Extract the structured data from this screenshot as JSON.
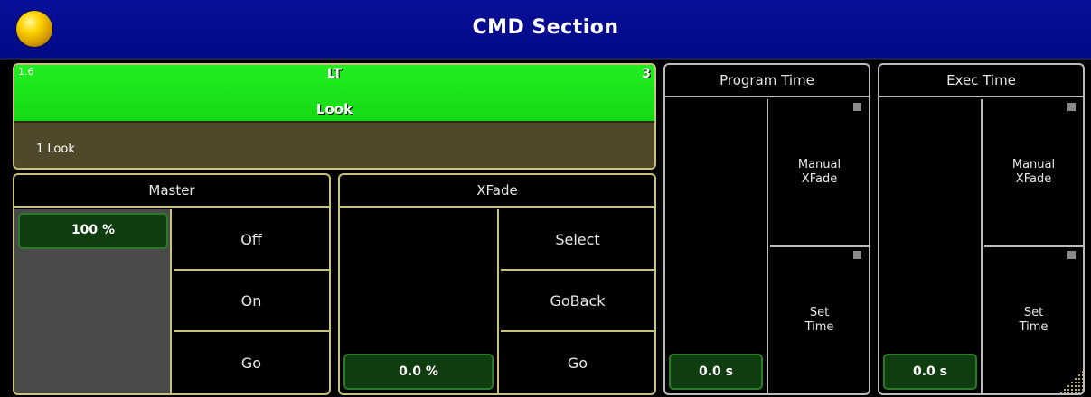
{
  "window": {
    "title": "CMD Section"
  },
  "executor": {
    "id": "1.6",
    "type": "LT",
    "count": "3",
    "name": "Look",
    "cue": "1 Look"
  },
  "master": {
    "title": "Master",
    "value": "100 %",
    "buttons": [
      "Off",
      "On",
      "Go"
    ]
  },
  "xfade": {
    "title": "XFade",
    "value": "0.0 %",
    "buttons": [
      "Select",
      "GoBack",
      "Go"
    ]
  },
  "program_time": {
    "title": "Program Time",
    "value": "0.0 s",
    "manual_label": "Manual\nXFade",
    "set_label": "Set\nTime"
  },
  "exec_time": {
    "title": "Exec Time",
    "value": "0.0 s",
    "manual_label": "Manual\nXFade",
    "set_label": "Set\nTime"
  },
  "colors": {
    "title_bar": "#0a0f9a",
    "executor_active": "#22ee22",
    "cue_bar": "#50482a",
    "panel_border": "#c9c27a",
    "value_box": "#0f3d0f"
  },
  "icons": {
    "title_ball": "status-ball-icon"
  }
}
